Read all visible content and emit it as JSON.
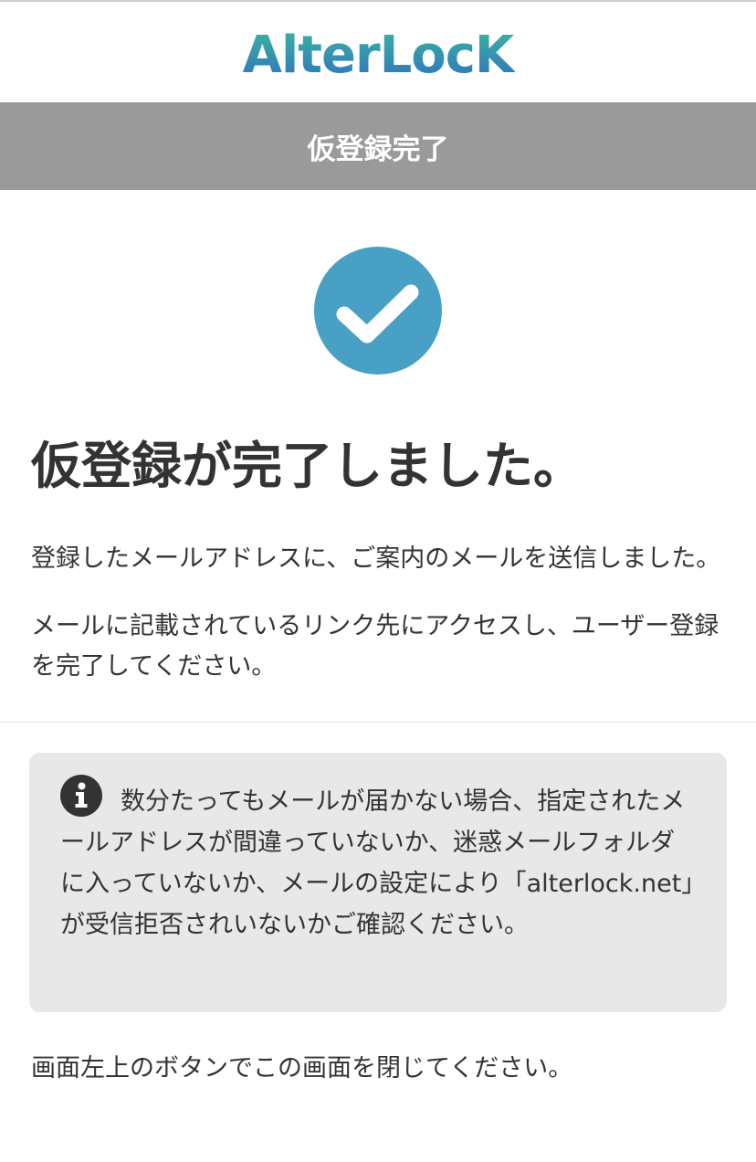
{
  "brand": {
    "logo_text": "AlterLocK",
    "logo_gradient": [
      "#3bb8a0",
      "#2f7fc6"
    ]
  },
  "header": {
    "title": "仮登録完了",
    "bar_color": "#9a9a9a"
  },
  "status": {
    "icon": "check-circle-icon",
    "color": "#48a0c4"
  },
  "main": {
    "headline": "仮登録が完了しました。",
    "paragraph_1": "登録したメールアドレスに、ご案内のメールを送信しました。",
    "paragraph_2": "メールに記載されているリンク先にアクセスし、ユーザー登録を完了してください。"
  },
  "notice": {
    "icon": "info-icon",
    "text": "数分たってもメールが届かない場合、指定されたメールアドレスが間違っていないか、迷惑メールフォルダに入っていないか、メールの設定により「alterlock.net」が受信拒否されいないかご確認ください。"
  },
  "footer": {
    "close_note": "画面左上のボタンでこの画面を閉じてください。"
  }
}
